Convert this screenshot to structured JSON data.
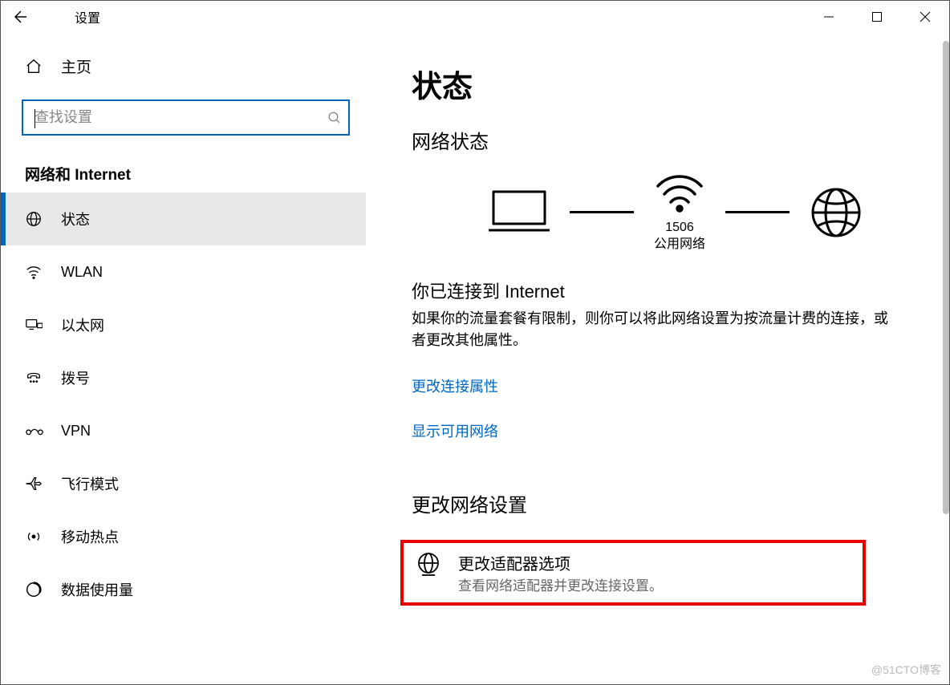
{
  "window": {
    "title": "设置"
  },
  "sidebar": {
    "home_label": "主页",
    "search_placeholder": "查找设置",
    "category": "网络和 Internet",
    "items": [
      {
        "label": "状态",
        "active": true
      },
      {
        "label": "WLAN"
      },
      {
        "label": "以太网"
      },
      {
        "label": "拨号"
      },
      {
        "label": "VPN"
      },
      {
        "label": "飞行模式"
      },
      {
        "label": "移动热点"
      },
      {
        "label": "数据使用量"
      }
    ]
  },
  "main": {
    "page_title": "状态",
    "section1_title": "网络状态",
    "diagram": {
      "ssid": "1506",
      "network_type": "公用网络"
    },
    "connected_heading": "你已连接到 Internet",
    "connected_body": "如果你的流量套餐有限制，则你可以将此网络设置为按流量计费的连接，或者更改其他属性。",
    "link_change_props": "更改连接属性",
    "link_show_networks": "显示可用网络",
    "section2_title": "更改网络设置",
    "adapter_option": {
      "title": "更改适配器选项",
      "desc": "查看网络适配器并更改连接设置。"
    }
  },
  "watermark": "@51CTO博客"
}
